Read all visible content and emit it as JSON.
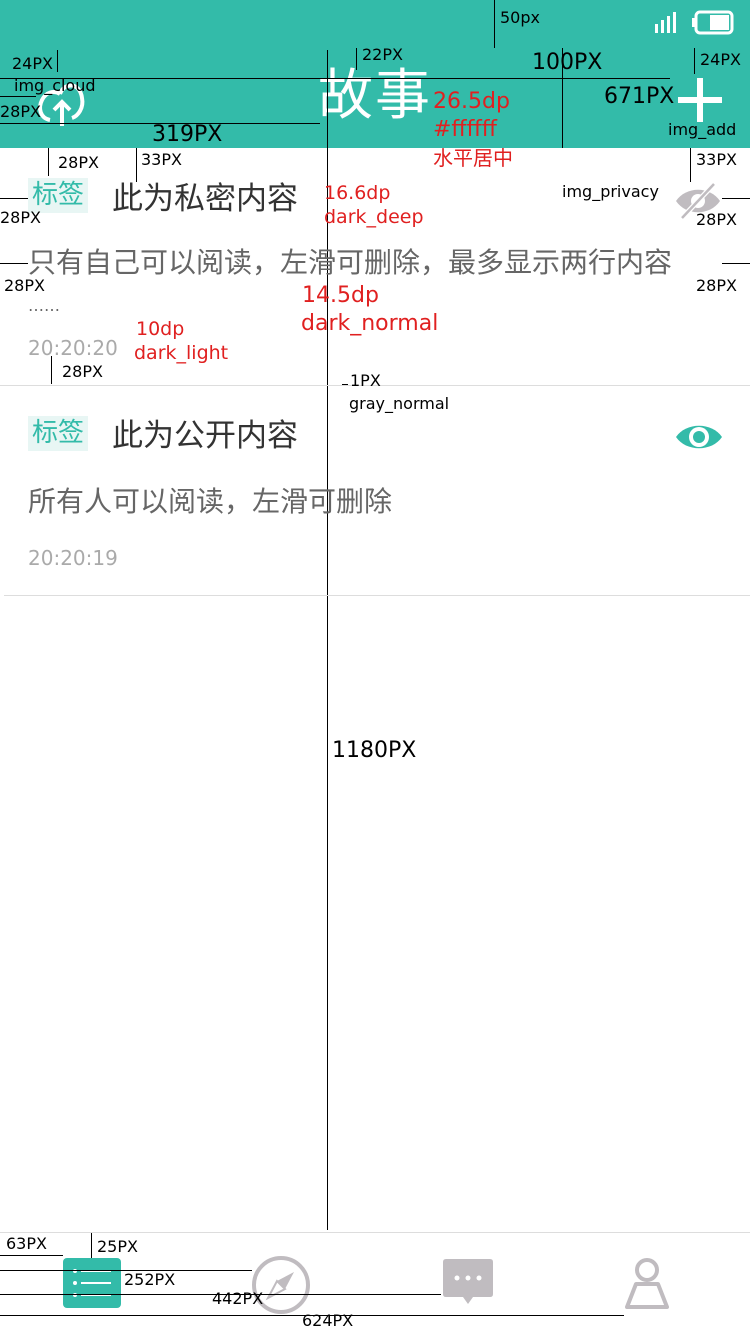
{
  "colors": {
    "accent": "#33bba9",
    "title_color": "#ffffff",
    "dark_light": "#aaaaaa",
    "gray_line": "#dddddd",
    "icon_gray": "#c0bcc0"
  },
  "status_bar": {
    "annotation": "50px"
  },
  "header": {
    "title": "故事",
    "annotations": {
      "cloud_top": "24PX",
      "cloud_label": "img_cloud",
      "cloud_left": "28PX",
      "title_x": "319PX",
      "title_top": "22PX",
      "height": "100PX",
      "add_x": "671PX",
      "add_top": "24PX",
      "add_label": "img_add",
      "title_size": "26.5dp",
      "title_color": "#ffffff",
      "title_align": "水平居中"
    }
  },
  "items": [
    {
      "tag": "标签",
      "title": "此为私密内容",
      "body": "只有自己可以阅读，左滑可删除，最多显示两行内容",
      "ellipsis": "……",
      "time": "20:20:20",
      "icon": "eye-hidden-icon"
    },
    {
      "tag": "标签",
      "title": "此为公开内容",
      "body": "所有人可以阅读，左滑可删除",
      "time": "20:20:19",
      "icon": "eye-icon"
    }
  ],
  "annotations": {
    "top_gap": "28PX",
    "tag_top": "33PX",
    "left_pad": "28PX",
    "title_size": "16.6dp",
    "title_color": "dark_deep",
    "privacy_label": "img_privacy",
    "privacy_top": "33PX",
    "right_pad": "28PX",
    "body_left": "28PX",
    "body_right": "28PX",
    "body_size": "14.5dp",
    "body_color": "dark_normal",
    "time_size": "10dp",
    "time_color": "dark_light",
    "bottom_gap": "28PX",
    "divider_h": "1PX",
    "divider_color": "gray_normal",
    "content_h": "1180PX"
  },
  "tabbar": {
    "tabs": [
      {
        "name": "list",
        "icon": "list-icon",
        "active": true
      },
      {
        "name": "discover",
        "icon": "compass-icon",
        "active": false
      },
      {
        "name": "messages",
        "icon": "chat-icon",
        "active": false
      },
      {
        "name": "profile",
        "icon": "person-icon",
        "active": false
      }
    ],
    "annotations": {
      "first_x": "63PX",
      "top": "25PX",
      "second_x": "252PX",
      "third_x": "442PX",
      "fourth_x": "624PX"
    }
  }
}
